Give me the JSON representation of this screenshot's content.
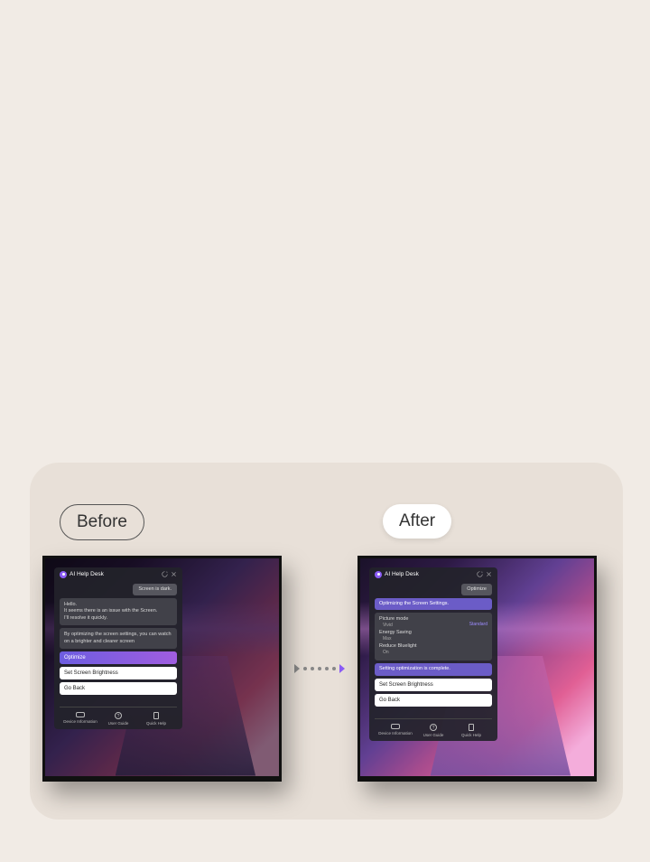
{
  "labels": {
    "before": "Before",
    "after": "After"
  },
  "panel": {
    "title": "AI Help Desk",
    "refresh_icon": "refresh",
    "close_icon": "close"
  },
  "before": {
    "user_msg": "Screen is dark.",
    "ai_msg1": "Hello.\nIt seems there is an issue with the Screen.\nI'll resolve it quickly.",
    "ai_msg2": "By optimizing the screen settings, you can watch on a brighter and clearer screen",
    "btn_optimize": "Optimize",
    "btn_brightness": "Set Screen Brightness",
    "btn_back": "Go Back"
  },
  "after": {
    "user_msg": "Optimize",
    "status_msg": "Optimizing the Screen Settings.",
    "settings": {
      "picture_mode": {
        "label": "Picture mode",
        "value": "Vivid",
        "link": "Standard"
      },
      "energy_saving": {
        "label": "Energy Saving",
        "value": "Max"
      },
      "reduce_bluelight": {
        "label": "Reduce Bluelight",
        "value": "On"
      }
    },
    "complete_msg": "Setting optimization is complete.",
    "btn_brightness": "Set Screen Brightness",
    "btn_back": "Go Back"
  },
  "footer": {
    "device_info": "Device Information",
    "user_guide": "User Guide",
    "quick_help": "Quick Help"
  }
}
